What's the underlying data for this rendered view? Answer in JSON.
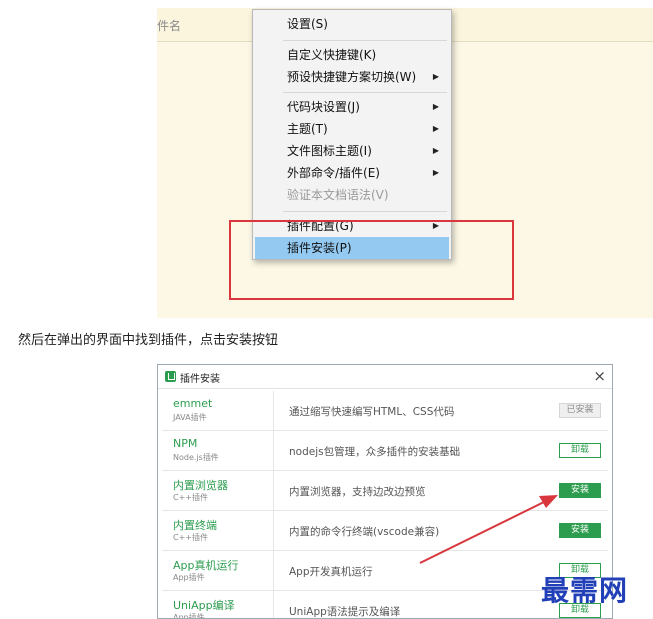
{
  "editor": {
    "filebar_label": "件名"
  },
  "context_menu": {
    "items": [
      {
        "label": "设置(S)",
        "submenu": false
      },
      {
        "label": "自定义快捷键(K)",
        "submenu": false
      },
      {
        "label": "预设快捷键方案切换(W)",
        "submenu": true
      },
      {
        "label": "代码块设置(J)",
        "submenu": true
      },
      {
        "label": "主题(T)",
        "submenu": true
      },
      {
        "label": "文件图标主题(I)",
        "submenu": true
      },
      {
        "label": "外部命令/插件(E)",
        "submenu": true
      },
      {
        "label": "验证本文档语法(V)",
        "submenu": false,
        "disabled": true
      },
      {
        "label": "插件配置(G)",
        "submenu": true
      },
      {
        "label": "插件安装(P)",
        "submenu": false,
        "highlighted": true
      }
    ],
    "arrow_glyph": "▶",
    "highlight_color": "#94c9f2"
  },
  "annotation": {
    "box_color": "#d9363e",
    "arrow_color": "#d9363e"
  },
  "caption": "然后在弹出的界面中找到插件，点击安装按钮",
  "plugin_dialog": {
    "title": "插件安装",
    "close_glyph": "×",
    "accent_color": "#2c9d4e",
    "plugins": [
      {
        "name": "emmet",
        "type": "JAVA插件",
        "description": "通过缩写快速编写HTML、CSS代码",
        "action": "已安装",
        "state": "installed"
      },
      {
        "name": "NPM",
        "type": "Node.js插件",
        "description": "nodejs包管理，众多插件的安装基础",
        "action": "卸载",
        "state": "uninstall"
      },
      {
        "name": "内置浏览器",
        "type": "C++插件",
        "description": "内置浏览器，支持边改边预览",
        "action": "安装",
        "state": "install"
      },
      {
        "name": "内置终端",
        "type": "C++插件",
        "description": "内置的命令行终端(vscode兼容)",
        "action": "安装",
        "state": "install"
      },
      {
        "name": "App真机运行",
        "type": "App插件",
        "description": "App开发真机运行",
        "action": "卸载",
        "state": "uninstall"
      },
      {
        "name": "UniApp编译",
        "type": "App插件",
        "description": "UniApp语法提示及编译",
        "action": "卸载",
        "state": "uninstall"
      }
    ]
  },
  "watermark": "最需网"
}
